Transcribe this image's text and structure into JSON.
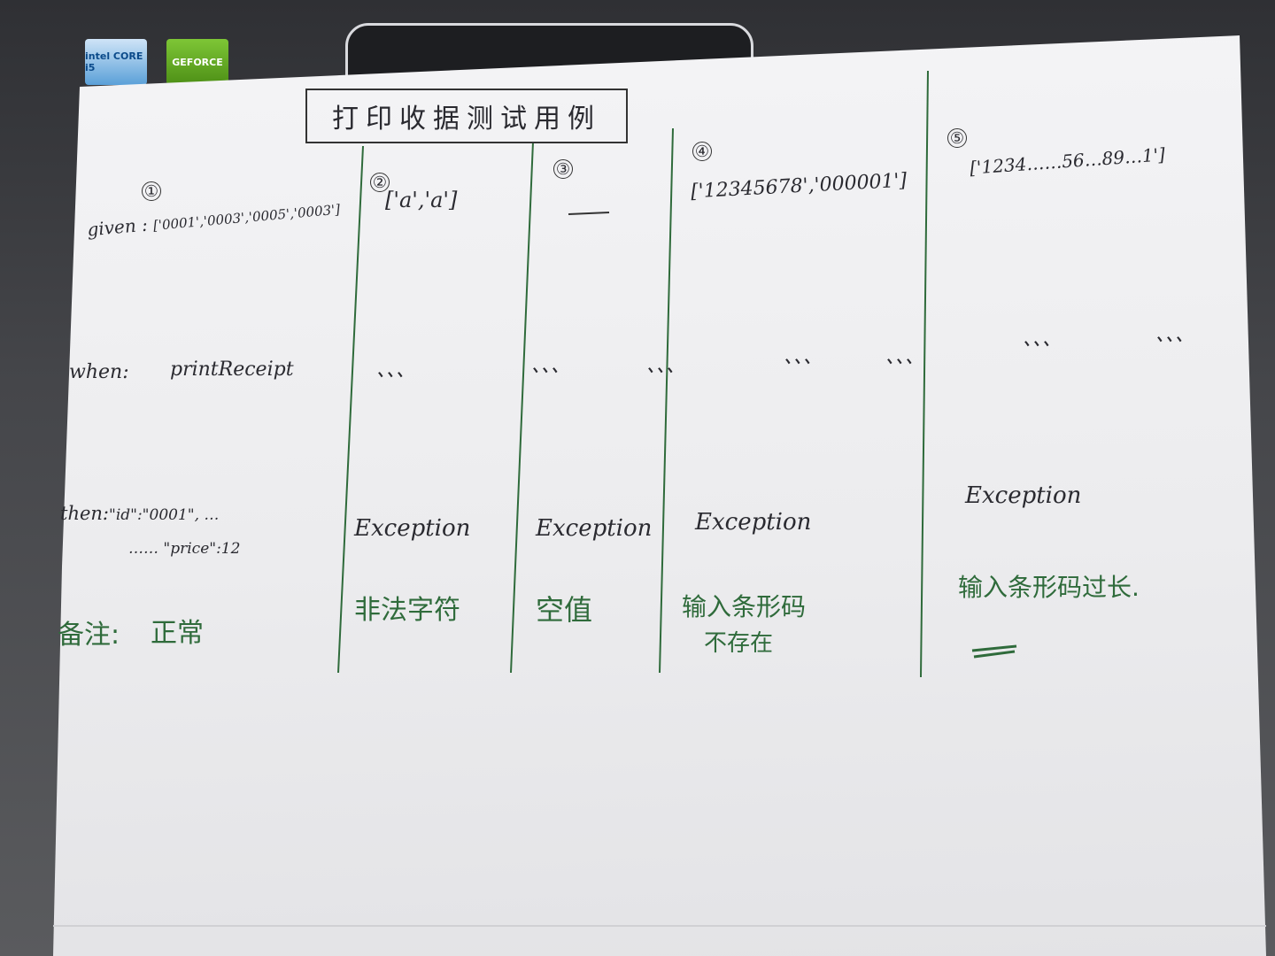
{
  "title": "打印收据测试用例",
  "rows": {
    "given": "given",
    "when": "when:",
    "then": "then:",
    "note": "备注:"
  },
  "cases": [
    {
      "number": "①",
      "given": "['0001','0003','0005','0003']",
      "when": "printReceipt",
      "then_line1": "\"id\":\"0001\", …",
      "then_line2": "…… \"price\":12",
      "note": "正常"
    },
    {
      "number": "②",
      "given": "['a','a']",
      "when": "、、、",
      "then": "Exception",
      "note": "非法字符"
    },
    {
      "number": "③",
      "given": "___",
      "when": "、、、",
      "then": "Exception",
      "note": "空值"
    },
    {
      "number": "④",
      "given": "['12345678','000001']",
      "when": "、、、",
      "then": "Exception",
      "note_line1": "输入条形码",
      "note_line2": "不存在"
    },
    {
      "number": "⑤",
      "given": "['1234……56…89…1']",
      "when": "、、、",
      "then": "Exception",
      "note": "输入条形码过长."
    }
  ],
  "stickers": {
    "intel": "intel CORE i5",
    "nvidia": "GEFORCE"
  }
}
